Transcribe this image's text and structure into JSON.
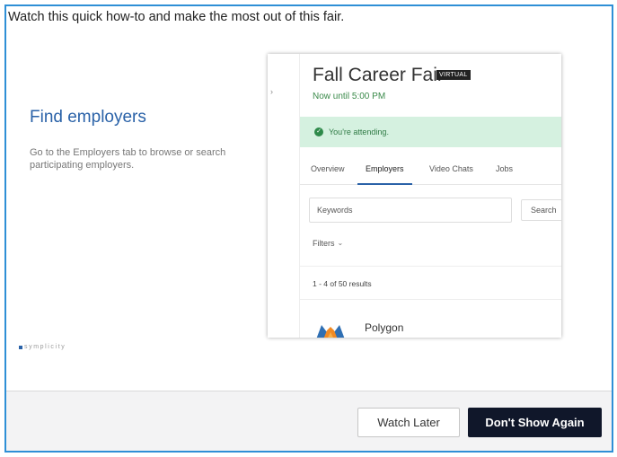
{
  "intro_text": "Watch this quick how-to and make the most out of this fair.",
  "slide": {
    "heading": "Find employers",
    "description": "Go to the Employers tab to browse or search participating employers.",
    "brand": "symplicity"
  },
  "preview": {
    "fair_title": "Fall Career Fair",
    "badge": "VIRTUAL",
    "time": "Now until 5:00 PM",
    "attending": "You're attending.",
    "tabs": [
      "Overview",
      "Employers",
      "Video Chats",
      "Jobs"
    ],
    "active_tab": "Employers",
    "keywords_placeholder": "Keywords",
    "search_label": "Search",
    "filters_label": "Filters",
    "results_text": "1 - 4 of 50 results",
    "employer_name": "Polygon"
  },
  "footer": {
    "watch_later": "Watch Later",
    "dont_show": "Don't Show Again"
  },
  "colors": {
    "border": "#2e8fd6",
    "heading": "#2a62a8",
    "attending_bg": "#d5f1e0",
    "primary_button": "#10172a"
  }
}
